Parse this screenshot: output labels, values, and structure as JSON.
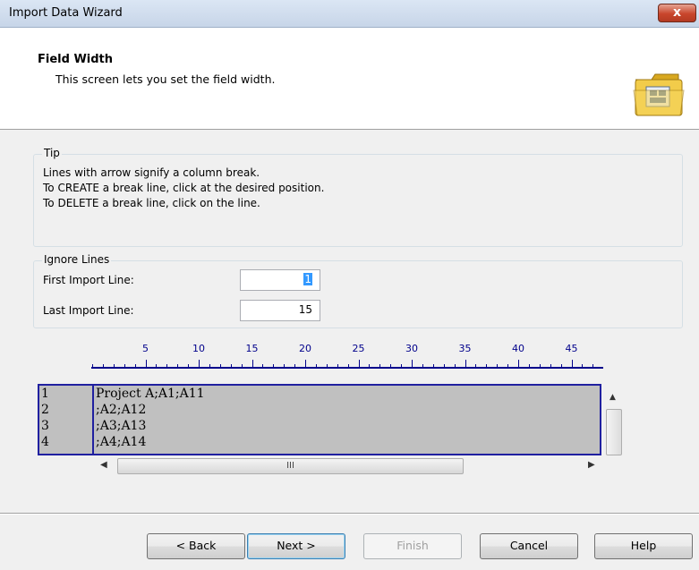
{
  "window": {
    "title": "Import Data Wizard",
    "close_glyph": "x"
  },
  "header": {
    "title": "Field Width",
    "subtitle": "This screen lets you set the field width.",
    "icon": "folder-icon"
  },
  "tip": {
    "legend": "Tip",
    "lines": [
      "Lines with arrow signify a column break.",
      "To CREATE a break line, click at the desired position.",
      "To DELETE a break line, click on the line."
    ]
  },
  "ignore_lines": {
    "legend": "Ignore Lines",
    "first_label": "First Import Line:",
    "first_value": "1",
    "last_label": "Last Import Line:",
    "last_value": "15"
  },
  "ruler": {
    "labels": [
      "5",
      "10",
      "15",
      "20",
      "25",
      "30",
      "35",
      "40",
      "45"
    ]
  },
  "preview": {
    "line_numbers": [
      "1",
      "2",
      "3",
      "4"
    ],
    "rows": [
      "Project A;A1;A11",
      ";A2;A12",
      ";A3;A13",
      ";A4;A14"
    ]
  },
  "scrollbar": {
    "thumb_grip": "III"
  },
  "buttons": {
    "back": "< Back",
    "next": "Next >",
    "finish": "Finish",
    "cancel": "Cancel",
    "help": "Help"
  }
}
